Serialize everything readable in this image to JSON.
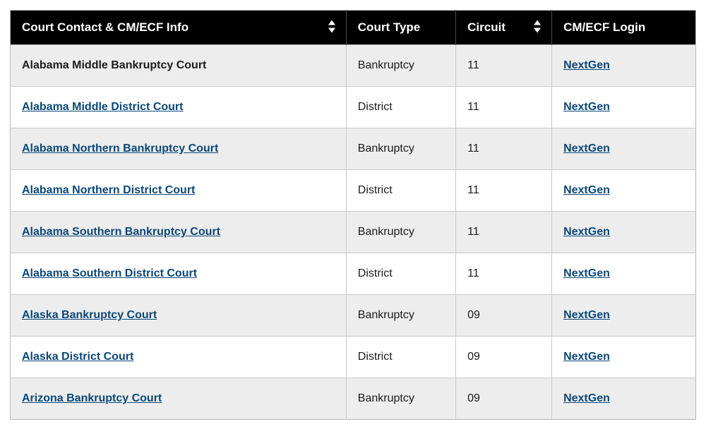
{
  "headers": {
    "name": "Court Contact & CM/ECF Info",
    "type": "Court Type",
    "circuit": "Circuit",
    "login": "CM/ECF Login"
  },
  "rows": [
    {
      "name": "Alabama Middle Bankruptcy Court",
      "name_is_link": false,
      "type": "Bankruptcy",
      "circuit": "11",
      "login": "NextGen"
    },
    {
      "name": "Alabama Middle District Court",
      "name_is_link": true,
      "type": "District",
      "circuit": "11",
      "login": "NextGen"
    },
    {
      "name": "Alabama Northern Bankruptcy Court",
      "name_is_link": true,
      "type": "Bankruptcy",
      "circuit": "11",
      "login": "NextGen"
    },
    {
      "name": "Alabama Northern District Court",
      "name_is_link": true,
      "type": "District",
      "circuit": "11",
      "login": "NextGen"
    },
    {
      "name": "Alabama Southern Bankruptcy Court",
      "name_is_link": true,
      "type": "Bankruptcy",
      "circuit": "11",
      "login": "NextGen"
    },
    {
      "name": "Alabama Southern District Court",
      "name_is_link": true,
      "type": "District",
      "circuit": "11",
      "login": "NextGen"
    },
    {
      "name": "Alaska Bankruptcy Court",
      "name_is_link": true,
      "type": "Bankruptcy",
      "circuit": "09",
      "login": "NextGen"
    },
    {
      "name": "Alaska District Court",
      "name_is_link": true,
      "type": "District",
      "circuit": "09",
      "login": "NextGen"
    },
    {
      "name": "Arizona Bankruptcy Court",
      "name_is_link": true,
      "type": "Bankruptcy",
      "circuit": "09",
      "login": "NextGen"
    }
  ]
}
